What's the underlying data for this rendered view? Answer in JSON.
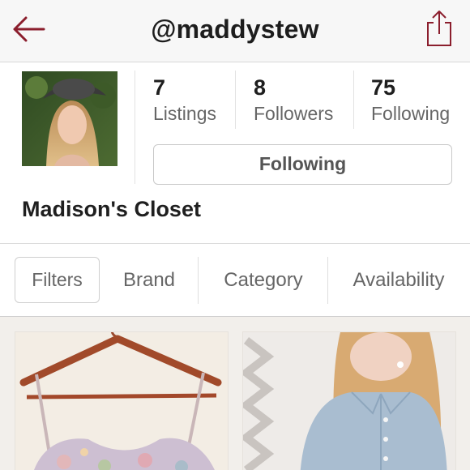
{
  "header": {
    "title": "@maddystew",
    "back_icon": "back-arrow-icon",
    "share_icon": "share-icon",
    "accent_color": "#8b1e2d"
  },
  "profile": {
    "avatar_alt": "profile photo",
    "stats": [
      {
        "value": "7",
        "label": "Listings"
      },
      {
        "value": "8",
        "label": "Followers"
      },
      {
        "value": "75",
        "label": "Following"
      }
    ],
    "follow_button_label": "Following",
    "closet_name": "Madison's Closet"
  },
  "filters": {
    "filters_label": "Filters",
    "tabs": [
      "Brand",
      "Category",
      "Availability"
    ]
  },
  "listings": [
    {
      "image": "floral-top-on-hanger"
    },
    {
      "image": "woman-in-chambray-shirt"
    }
  ]
}
